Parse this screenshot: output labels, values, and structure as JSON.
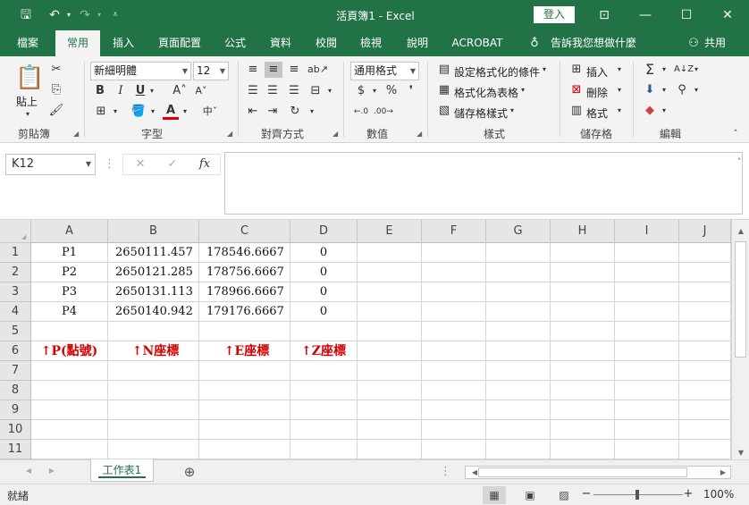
{
  "window": {
    "title": "活頁簿1 - Excel",
    "login_label": "登入"
  },
  "tabs": [
    {
      "label": "檔案"
    },
    {
      "label": "常用"
    },
    {
      "label": "插入"
    },
    {
      "label": "頁面配置"
    },
    {
      "label": "公式"
    },
    {
      "label": "資料"
    },
    {
      "label": "校閱"
    },
    {
      "label": "檢視"
    },
    {
      "label": "說明"
    },
    {
      "label": "ACROBAT"
    }
  ],
  "tell_me": "告訴我您想做什麼",
  "share": "共用",
  "ribbon": {
    "paste_label": "貼上",
    "font_name": "新細明體",
    "font_size": "12",
    "number_format": "通用格式",
    "conditional_format": "設定格式化的條件",
    "format_as_table": "格式化為表格",
    "cell_styles": "儲存格樣式",
    "insert": "插入",
    "delete": "刪除",
    "format": "格式",
    "groups": {
      "clipboard": "剪貼簿",
      "font": "字型",
      "alignment": "對齊方式",
      "number": "數值",
      "styles": "樣式",
      "cells": "儲存格",
      "editing": "編輯"
    }
  },
  "name_box": "K12",
  "columns": [
    "A",
    "B",
    "C",
    "D",
    "E",
    "F",
    "G",
    "H",
    "I",
    "J"
  ],
  "rows": [
    "1",
    "2",
    "3",
    "4",
    "5",
    "6",
    "7",
    "8",
    "9",
    "10",
    "11"
  ],
  "cells": {
    "A1": "P1",
    "B1": "2650111.457",
    "C1": "178546.6667",
    "D1": "0",
    "A2": "P2",
    "B2": "2650121.285",
    "C2": "178756.6667",
    "D2": "0",
    "A3": "P3",
    "B3": "2650131.113",
    "C3": "178966.6667",
    "D3": "0",
    "A4": "P4",
    "B4": "2650140.942",
    "C4": "179176.6667",
    "D4": "0",
    "A6": "↑P(點號)",
    "B6": "↑N座標",
    "C6": "↑E座標",
    "D6": "↑Z座標"
  },
  "sheet_tab": "工作表1",
  "status": "就緒",
  "zoom": "100%",
  "colors": {
    "brand": "#217346",
    "annotation": "#d40000"
  }
}
